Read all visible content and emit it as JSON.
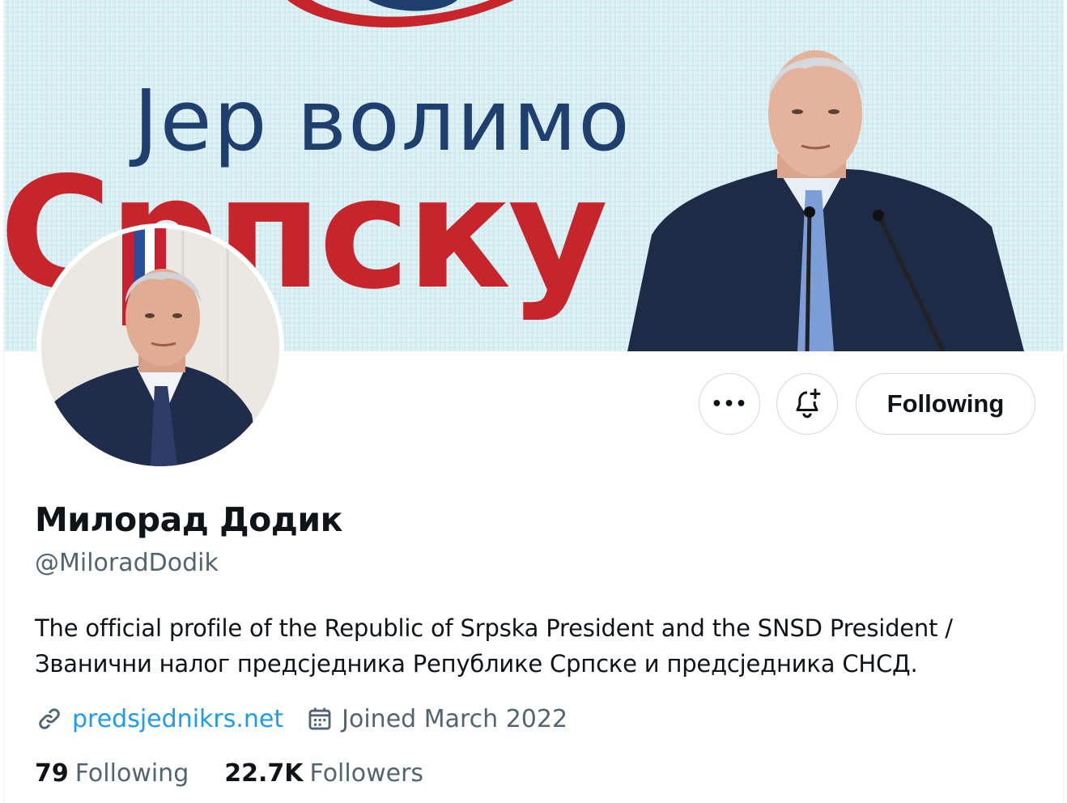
{
  "banner": {
    "headline_top": "Јер волимо",
    "headline_bottom": "Српску"
  },
  "actions": {
    "more_label": "•••",
    "notify_icon": "bell-plus-icon",
    "following_label": "Following"
  },
  "profile": {
    "display_name": "Милорад Додик",
    "handle": "@MiloradDodik",
    "bio_line_1": "The official profile of the Republic of Srpska President and the SNSD President /",
    "bio_line_2": "Званични налог предсједника Републике Српске и предсједника СНСД.",
    "website": "predsjednikrs.net",
    "joined": "Joined March 2022"
  },
  "stats": {
    "following_count": "79",
    "following_label": "Following",
    "followers_count": "22.7K",
    "followers_label": "Followers"
  },
  "colors": {
    "link": "#1d9bf0",
    "secondary_text": "#536471",
    "primary_text": "#0f1419",
    "border": "#cfd9de",
    "banner_red": "#c6252c",
    "banner_blue": "#1f3f6e"
  }
}
